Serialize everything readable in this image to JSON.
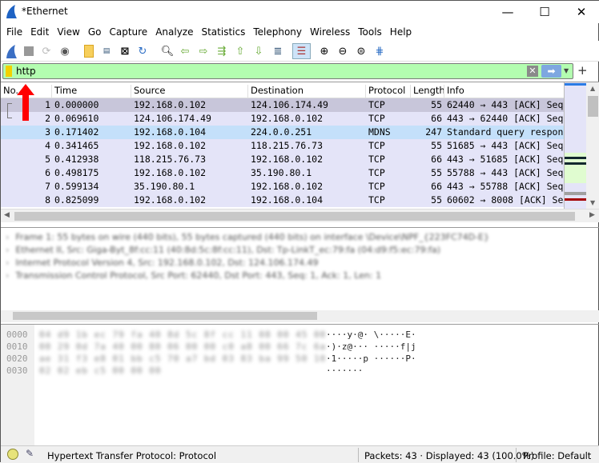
{
  "window": {
    "title": "*Ethernet",
    "minimize": "—",
    "maximize": "☐",
    "close": "✕"
  },
  "menu": [
    "File",
    "Edit",
    "View",
    "Go",
    "Capture",
    "Analyze",
    "Statistics",
    "Telephony",
    "Wireless",
    "Tools",
    "Help"
  ],
  "filter": {
    "value": "http",
    "clear": "✕",
    "apply": "➡",
    "dropdown": "▼",
    "add": "+"
  },
  "columns": [
    "No.",
    "Time",
    "Source",
    "Destination",
    "Protocol",
    "Length",
    "Info"
  ],
  "packets": [
    {
      "no": "1",
      "time": "0.000000",
      "src": "192.168.0.102",
      "dst": "124.106.174.49",
      "proto": "TCP",
      "len": "55",
      "info": "62440 → 443 [ACK] Seq"
    },
    {
      "no": "2",
      "time": "0.069610",
      "src": "124.106.174.49",
      "dst": "192.168.0.102",
      "proto": "TCP",
      "len": "66",
      "info": "443 → 62440 [ACK] Seq"
    },
    {
      "no": "3",
      "time": "0.171402",
      "src": "192.168.0.104",
      "dst": "224.0.0.251",
      "proto": "MDNS",
      "len": "247",
      "info": "Standard query respon"
    },
    {
      "no": "4",
      "time": "0.341465",
      "src": "192.168.0.102",
      "dst": "118.215.76.73",
      "proto": "TCP",
      "len": "55",
      "info": "51685 → 443 [ACK] Seq"
    },
    {
      "no": "5",
      "time": "0.412938",
      "src": "118.215.76.73",
      "dst": "192.168.0.102",
      "proto": "TCP",
      "len": "66",
      "info": "443 → 51685 [ACK] Seq"
    },
    {
      "no": "6",
      "time": "0.498175",
      "src": "192.168.0.102",
      "dst": "35.190.80.1",
      "proto": "TCP",
      "len": "55",
      "info": "55788 → 443 [ACK] Seq"
    },
    {
      "no": "7",
      "time": "0.599134",
      "src": "35.190.80.1",
      "dst": "192.168.0.102",
      "proto": "TCP",
      "len": "66",
      "info": "443 → 55788 [ACK] Seq"
    },
    {
      "no": "8",
      "time": "0.825099",
      "src": "192.168.0.102",
      "dst": "192.168.0.104",
      "proto": "TCP",
      "len": "55",
      "info": "60602 → 8008 [ACK] Se"
    }
  ],
  "details": [
    "Frame 1: 55 bytes on wire (440 bits), 55 bytes captured (440 bits) on interface \\Device\\NPF_{223FC74D-E}",
    "Ethernet II, Src: Giga-Byt_8f:cc:11 (40:8d:5c:8f:cc:11), Dst: Tp-LinkT_ec:79:fa (04:d9:f5:ec:79:fa)",
    "Internet Protocol Version 4, Src: 192.168.0.102, Dst: 124.106.174.49",
    "Transmission Control Protocol, Src Port: 62440, Dst Port: 443, Seq: 1, Ack: 1, Len: 1"
  ],
  "hex": [
    {
      "offset": "0000",
      "bytes": "04 d9 1b ec 79 fa 40 8d  5c 8f cc 11 08 00 45 00",
      "ascii": "····y·@· \\·····E·"
    },
    {
      "offset": "0010",
      "bytes": "00 29 0d 7a 40 00 80 06  00 00 c0 a8 00 66 7c 6a",
      "ascii": "·)·z@··· ·····f|j"
    },
    {
      "offset": "0020",
      "bytes": "ae 31 f3 e8 01 bb c5 70  a7 bd 03 83 ba 99 50 10",
      "ascii": "·1·····p ······P·"
    },
    {
      "offset": "0030",
      "bytes": "02 02 eb c5 00 00 00",
      "ascii": "·······"
    }
  ],
  "status": {
    "field": "Hypertext Transfer Protocol: Protocol",
    "packets": "Packets: 43 · Displayed: 43 (100.0%)",
    "profile": "Profile: Default"
  },
  "colors": {
    "tcp_row": "#e4e4f8",
    "udp_row": "#c4e0fa",
    "selected_row": "#c8c6da",
    "filter_valid": "#b3fdb0",
    "arrow": "#ff0000"
  }
}
